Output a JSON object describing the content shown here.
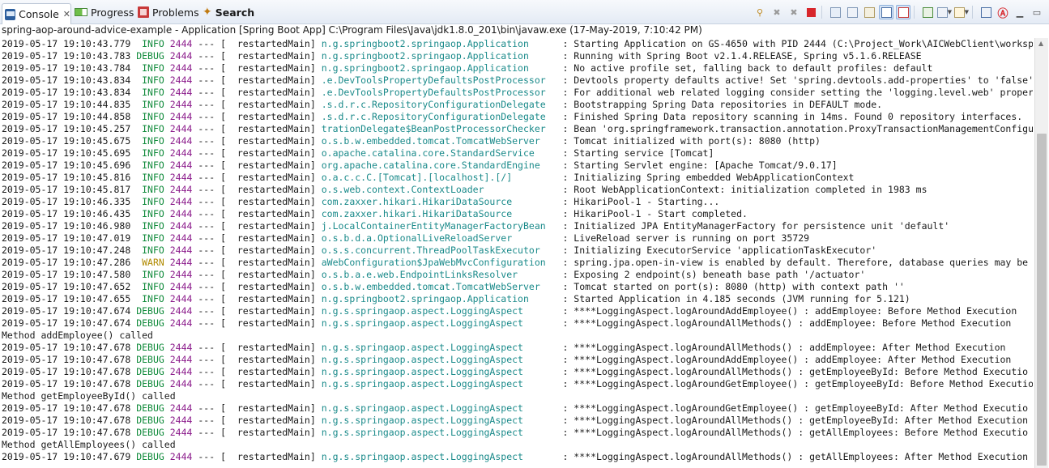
{
  "tabs": [
    {
      "label": "Console",
      "icon": "console-icon",
      "active": true
    },
    {
      "label": "Progress",
      "icon": "progress-icon"
    },
    {
      "label": "Problems",
      "icon": "problems-icon"
    },
    {
      "label": "Search",
      "icon": "search-icon"
    }
  ],
  "close_glyph": "✕",
  "toolbar_icons": [
    "pin-icon",
    "remove-launch-icon",
    "remove-all-icon",
    "terminate-icon",
    "separator",
    "clear-console-icon",
    "scroll-lock-icon",
    "word-wrap-icon",
    "show-stdout-icon",
    "show-stderr-icon",
    "separator",
    "display-selected-icon",
    "open-console-icon",
    "new-console-icon",
    "separator",
    "view-menu-icon",
    "minimize-icon",
    "maximize-icon"
  ],
  "console_title": "spring-aop-around-advice-example - Application [Spring Boot App] C:\\Program Files\\Java\\jdk1.8.0_201\\bin\\javaw.exe (17-May-2019, 7:10:42 PM)",
  "log_rows": [
    {
      "ts": "2019-05-17 19:10:43.779",
      "level": " INFO",
      "pid": "2444",
      "thread": "  restartedMain]",
      "logger": "n.g.springboot2.springaop.Application     ",
      "msg": ": Starting Application on GS-4650 with PID 2444 (C:\\Project_Work\\AICWebClient\\worksp"
    },
    {
      "ts": "2019-05-17 19:10:43.783",
      "level": "DEBUG",
      "pid": "2444",
      "thread": "  restartedMain]",
      "logger": "n.g.springboot2.springaop.Application     ",
      "msg": ": Running with Spring Boot v2.1.4.RELEASE, Spring v5.1.6.RELEASE"
    },
    {
      "ts": "2019-05-17 19:10:43.784",
      "level": " INFO",
      "pid": "2444",
      "thread": "  restartedMain]",
      "logger": "n.g.springboot2.springaop.Application     ",
      "msg": ": No active profile set, falling back to default profiles: default"
    },
    {
      "ts": "2019-05-17 19:10:43.834",
      "level": " INFO",
      "pid": "2444",
      "thread": "  restartedMain]",
      "logger": ".e.DevToolsPropertyDefaultsPostProcessor  ",
      "msg": ": Devtools property defaults active! Set 'spring.devtools.add-properties' to 'false'"
    },
    {
      "ts": "2019-05-17 19:10:43.834",
      "level": " INFO",
      "pid": "2444",
      "thread": "  restartedMain]",
      "logger": ".e.DevToolsPropertyDefaultsPostProcessor  ",
      "msg": ": For additional web related logging consider setting the 'logging.level.web' proper"
    },
    {
      "ts": "2019-05-17 19:10:44.835",
      "level": " INFO",
      "pid": "2444",
      "thread": "  restartedMain]",
      "logger": ".s.d.r.c.RepositoryConfigurationDelegate  ",
      "msg": ": Bootstrapping Spring Data repositories in DEFAULT mode."
    },
    {
      "ts": "2019-05-17 19:10:44.858",
      "level": " INFO",
      "pid": "2444",
      "thread": "  restartedMain]",
      "logger": ".s.d.r.c.RepositoryConfigurationDelegate  ",
      "msg": ": Finished Spring Data repository scanning in 14ms. Found 0 repository interfaces."
    },
    {
      "ts": "2019-05-17 19:10:45.257",
      "level": " INFO",
      "pid": "2444",
      "thread": "  restartedMain]",
      "logger": "trationDelegate$BeanPostProcessorChecker  ",
      "msg": ": Bean 'org.springframework.transaction.annotation.ProxyTransactionManagementConfigu"
    },
    {
      "ts": "2019-05-17 19:10:45.675",
      "level": " INFO",
      "pid": "2444",
      "thread": "  restartedMain]",
      "logger": "o.s.b.w.embedded.tomcat.TomcatWebServer   ",
      "msg": ": Tomcat initialized with port(s): 8080 (http)"
    },
    {
      "ts": "2019-05-17 19:10:45.695",
      "level": " INFO",
      "pid": "2444",
      "thread": "  restartedMain]",
      "logger": "o.apache.catalina.core.StandardService    ",
      "msg": ": Starting service [Tomcat]"
    },
    {
      "ts": "2019-05-17 19:10:45.696",
      "level": " INFO",
      "pid": "2444",
      "thread": "  restartedMain]",
      "logger": "org.apache.catalina.core.StandardEngine   ",
      "msg": ": Starting Servlet engine: [Apache Tomcat/9.0.17]"
    },
    {
      "ts": "2019-05-17 19:10:45.816",
      "level": " INFO",
      "pid": "2444",
      "thread": "  restartedMain]",
      "logger": "o.a.c.c.C.[Tomcat].[localhost].[/]        ",
      "msg": ": Initializing Spring embedded WebApplicationContext"
    },
    {
      "ts": "2019-05-17 19:10:45.817",
      "level": " INFO",
      "pid": "2444",
      "thread": "  restartedMain]",
      "logger": "o.s.web.context.ContextLoader             ",
      "msg": ": Root WebApplicationContext: initialization completed in 1983 ms"
    },
    {
      "ts": "2019-05-17 19:10:46.335",
      "level": " INFO",
      "pid": "2444",
      "thread": "  restartedMain]",
      "logger": "com.zaxxer.hikari.HikariDataSource        ",
      "msg": ": HikariPool-1 - Starting..."
    },
    {
      "ts": "2019-05-17 19:10:46.435",
      "level": " INFO",
      "pid": "2444",
      "thread": "  restartedMain]",
      "logger": "com.zaxxer.hikari.HikariDataSource        ",
      "msg": ": HikariPool-1 - Start completed."
    },
    {
      "ts": "2019-05-17 19:10:46.980",
      "level": " INFO",
      "pid": "2444",
      "thread": "  restartedMain]",
      "logger": "j.LocalContainerEntityManagerFactoryBean  ",
      "msg": ": Initialized JPA EntityManagerFactory for persistence unit 'default'"
    },
    {
      "ts": "2019-05-17 19:10:47.019",
      "level": " INFO",
      "pid": "2444",
      "thread": "  restartedMain]",
      "logger": "o.s.b.d.a.OptionalLiveReloadServer        ",
      "msg": ": LiveReload server is running on port 35729"
    },
    {
      "ts": "2019-05-17 19:10:47.248",
      "level": " INFO",
      "pid": "2444",
      "thread": "  restartedMain]",
      "logger": "o.s.s.concurrent.ThreadPoolTaskExecutor   ",
      "msg": ": Initializing ExecutorService 'applicationTaskExecutor'"
    },
    {
      "ts": "2019-05-17 19:10:47.286",
      "level": " WARN",
      "pid": "2444",
      "thread": "  restartedMain]",
      "logger": "aWebConfiguration$JpaWebMvcConfiguration  ",
      "msg": ": spring.jpa.open-in-view is enabled by default. Therefore, database queries may be"
    },
    {
      "ts": "2019-05-17 19:10:47.580",
      "level": " INFO",
      "pid": "2444",
      "thread": "  restartedMain]",
      "logger": "o.s.b.a.e.web.EndpointLinksResolver       ",
      "msg": ": Exposing 2 endpoint(s) beneath base path '/actuator'"
    },
    {
      "ts": "2019-05-17 19:10:47.652",
      "level": " INFO",
      "pid": "2444",
      "thread": "  restartedMain]",
      "logger": "o.s.b.w.embedded.tomcat.TomcatWebServer   ",
      "msg": ": Tomcat started on port(s): 8080 (http) with context path ''"
    },
    {
      "ts": "2019-05-17 19:10:47.655",
      "level": " INFO",
      "pid": "2444",
      "thread": "  restartedMain]",
      "logger": "n.g.springboot2.springaop.Application     ",
      "msg": ": Started Application in 4.185 seconds (JVM running for 5.121)"
    },
    {
      "ts": "2019-05-17 19:10:47.674",
      "level": "DEBUG",
      "pid": "2444",
      "thread": "  restartedMain]",
      "logger": "n.g.s.springaop.aspect.LoggingAspect      ",
      "msg": ": ****LoggingAspect.logAroundAddEmployee() : addEmployee: Before Method Execution"
    },
    {
      "ts": "2019-05-17 19:10:47.674",
      "level": "DEBUG",
      "pid": "2444",
      "thread": "  restartedMain]",
      "logger": "n.g.s.springaop.aspect.LoggingAspect      ",
      "msg": ": ****LoggingAspect.logAroundAllMethods() : addEmployee: Before Method Execution"
    },
    {
      "plain": "Method addEmployee() called"
    },
    {
      "ts": "2019-05-17 19:10:47.678",
      "level": "DEBUG",
      "pid": "2444",
      "thread": "  restartedMain]",
      "logger": "n.g.s.springaop.aspect.LoggingAspect      ",
      "msg": ": ****LoggingAspect.logAroundAllMethods() : addEmployee: After Method Execution"
    },
    {
      "ts": "2019-05-17 19:10:47.678",
      "level": "DEBUG",
      "pid": "2444",
      "thread": "  restartedMain]",
      "logger": "n.g.s.springaop.aspect.LoggingAspect      ",
      "msg": ": ****LoggingAspect.logAroundAddEmployee() : addEmployee: After Method Execution"
    },
    {
      "ts": "2019-05-17 19:10:47.678",
      "level": "DEBUG",
      "pid": "2444",
      "thread": "  restartedMain]",
      "logger": "n.g.s.springaop.aspect.LoggingAspect      ",
      "msg": ": ****LoggingAspect.logAroundAllMethods() : getEmployeeById: Before Method Executio"
    },
    {
      "ts": "2019-05-17 19:10:47.678",
      "level": "DEBUG",
      "pid": "2444",
      "thread": "  restartedMain]",
      "logger": "n.g.s.springaop.aspect.LoggingAspect      ",
      "msg": ": ****LoggingAspect.logAroundGetEmployee() : getEmployeeById: Before Method Executio"
    },
    {
      "plain": "Method getEmployeeById() called"
    },
    {
      "ts": "2019-05-17 19:10:47.678",
      "level": "DEBUG",
      "pid": "2444",
      "thread": "  restartedMain]",
      "logger": "n.g.s.springaop.aspect.LoggingAspect      ",
      "msg": ": ****LoggingAspect.logAroundGetEmployee() : getEmployeeById: After Method Executio"
    },
    {
      "ts": "2019-05-17 19:10:47.678",
      "level": "DEBUG",
      "pid": "2444",
      "thread": "  restartedMain]",
      "logger": "n.g.s.springaop.aspect.LoggingAspect      ",
      "msg": ": ****LoggingAspect.logAroundAllMethods() : getEmployeeById: After Method Execution"
    },
    {
      "ts": "2019-05-17 19:10:47.678",
      "level": "DEBUG",
      "pid": "2444",
      "thread": "  restartedMain]",
      "logger": "n.g.s.springaop.aspect.LoggingAspect      ",
      "msg": ": ****LoggingAspect.logAroundAllMethods() : getAllEmployees: Before Method Executio"
    },
    {
      "plain": "Method getAllEmployees() called"
    },
    {
      "ts": "2019-05-17 19:10:47.679",
      "level": "DEBUG",
      "pid": "2444",
      "thread": "  restartedMain]",
      "logger": "n.g.s.springaop.aspect.LoggingAspect      ",
      "msg": ": ****LoggingAspect.logAroundAllMethods() : getAllEmployees: After Method Execution"
    }
  ]
}
